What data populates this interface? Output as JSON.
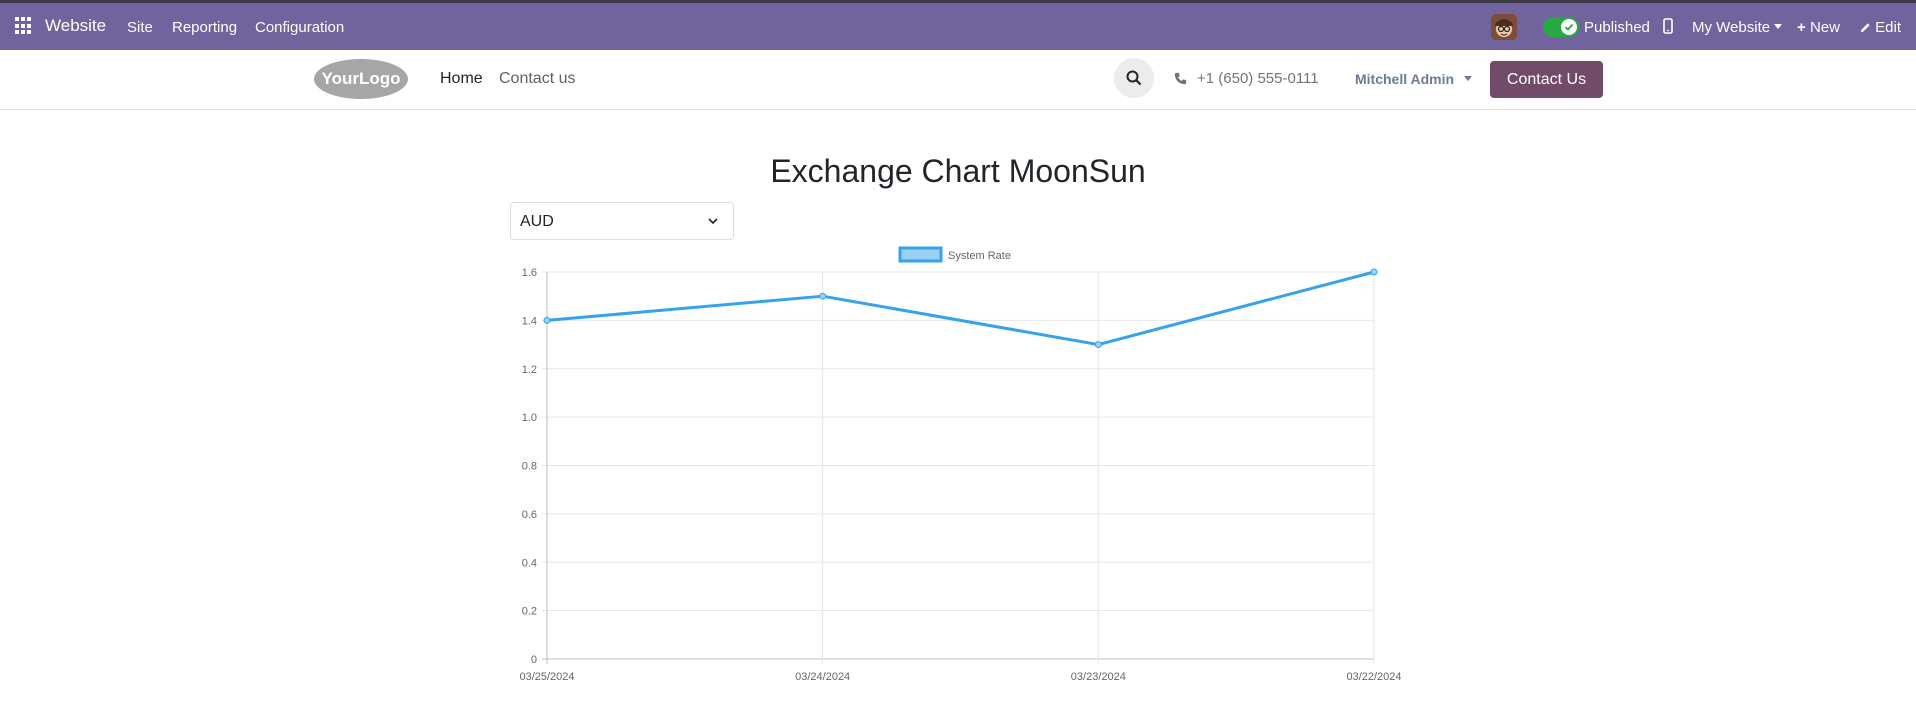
{
  "admin_bar": {
    "app_name": "Website",
    "menus": [
      "Site",
      "Reporting",
      "Configuration"
    ],
    "published_label": "Published",
    "my_website_label": "My Website",
    "new_label": "New",
    "edit_label": "Edit"
  },
  "site_header": {
    "logo_text": "YourLogo",
    "nav": [
      "Home",
      "Contact us"
    ],
    "phone": "+1 (650) 555-0111",
    "user_name": "Mitchell Admin",
    "contact_button": "Contact Us"
  },
  "main": {
    "title": "Exchange Chart MoonSun",
    "currency_selected": "AUD"
  },
  "chart_data": {
    "type": "line",
    "x": [
      "03/25/2024",
      "03/24/2024",
      "03/23/2024",
      "03/22/2024"
    ],
    "series": [
      {
        "name": "System Rate",
        "values": [
          1.4,
          1.5,
          1.3,
          1.6
        ],
        "color": "#36a2eb"
      }
    ],
    "ylim": [
      0,
      1.6
    ],
    "yticks": [
      "0",
      "0.2",
      "0.4",
      "0.6",
      "0.8",
      "1.0",
      "1.2",
      "1.4",
      "1.6"
    ],
    "grid": true,
    "legend": "top-center"
  },
  "colors": {
    "admin_bar": "#71639e",
    "contact_button": "#714b67",
    "series_line": "#36a2eb"
  }
}
